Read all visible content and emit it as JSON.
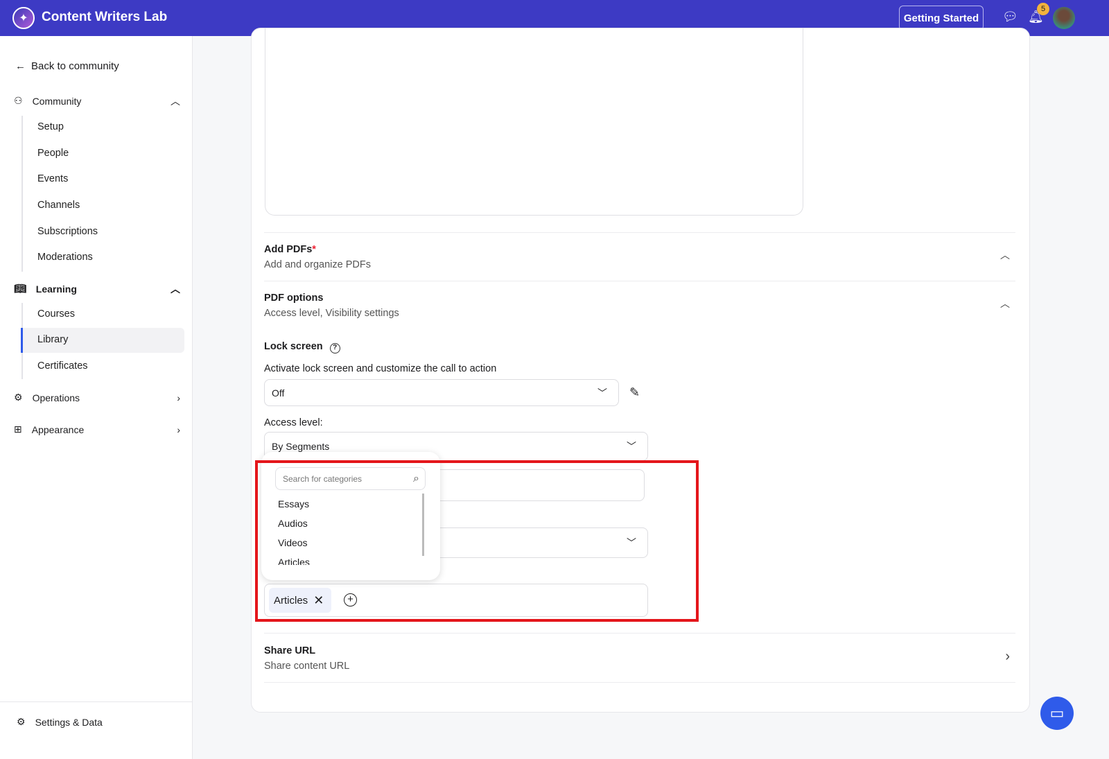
{
  "header": {
    "title": "Content Writers Lab",
    "getting_started": "Getting Started",
    "notification_count": "5"
  },
  "sidebar": {
    "back": "Back to community",
    "community": {
      "label": "Community",
      "items": [
        "Setup",
        "People",
        "Events",
        "Channels",
        "Subscriptions",
        "Moderations"
      ]
    },
    "learning": {
      "label": "Learning",
      "items": [
        "Courses",
        "Library",
        "Certificates"
      ]
    },
    "operations": "Operations",
    "appearance": "Appearance",
    "settings": "Settings & Data"
  },
  "main": {
    "add_pdfs": {
      "title": "Add PDFs",
      "required": "*",
      "subtitle": "Add and organize PDFs"
    },
    "pdf_options": {
      "title": "PDF options",
      "subtitle": "Access level, Visibility settings"
    },
    "lock_screen": {
      "label": "Lock screen",
      "description": "Activate lock screen and customize the call to action",
      "value": "Off"
    },
    "access_level": {
      "label": "Access level:",
      "value": "By Segments"
    },
    "categories": {
      "search_placeholder": "Search for categories",
      "options": [
        "Essays",
        "Audios",
        "Videos",
        "Articles"
      ],
      "selected": [
        "Articles"
      ]
    },
    "share_url": {
      "title": "Share URL",
      "subtitle": "Share content URL"
    }
  }
}
